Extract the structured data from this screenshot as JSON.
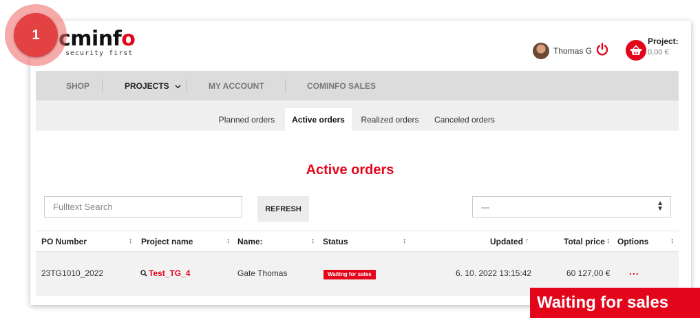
{
  "badge": {
    "step": "1"
  },
  "logo": {
    "word_pre": "c",
    "word_main": "minf",
    "word_o": "o",
    "tagline": "security first"
  },
  "user": {
    "name": "Thomas G"
  },
  "project": {
    "label": "Project:",
    "value": "0,00 €"
  },
  "nav": {
    "items": [
      {
        "label": "SHOP"
      },
      {
        "label": "PROJECTS",
        "active": true
      },
      {
        "label": "MY ACCOUNT"
      },
      {
        "label": "COMINFO SALES"
      }
    ]
  },
  "subnav": {
    "items": [
      {
        "label": "Planned orders"
      },
      {
        "label": "Active orders",
        "active": true
      },
      {
        "label": "Realized orders"
      },
      {
        "label": "Canceled orders"
      }
    ]
  },
  "title": "Active orders",
  "search": {
    "placeholder": "Fulltext Search"
  },
  "refresh_label": "REFRESH",
  "filter": {
    "value": "---"
  },
  "table": {
    "headers": [
      "PO Number",
      "Project name",
      "Name:",
      "Status",
      "Updated",
      "Total price",
      "Options"
    ],
    "sort_markers": {
      "default": "↕",
      "updated": "↑"
    },
    "rows": [
      {
        "po_number": "23TG1010_2022",
        "project_name": "Test_TG_4",
        "name": "Gate Thomas",
        "status": "Waiting for sales",
        "updated": "6. 10. 2022 13:15:42",
        "total_price": "60 127,00 €",
        "options": "..."
      }
    ]
  },
  "callout": "Waiting for sales",
  "colors": {
    "accent": "#e3061b",
    "nav_bg": "#dcdcdc",
    "subnav_bg": "#efefef",
    "row_bg": "#f2f2f2"
  },
  "icons": [
    "power-icon",
    "basket-icon",
    "search-icon",
    "chevron-down-icon",
    "sort-icon"
  ]
}
